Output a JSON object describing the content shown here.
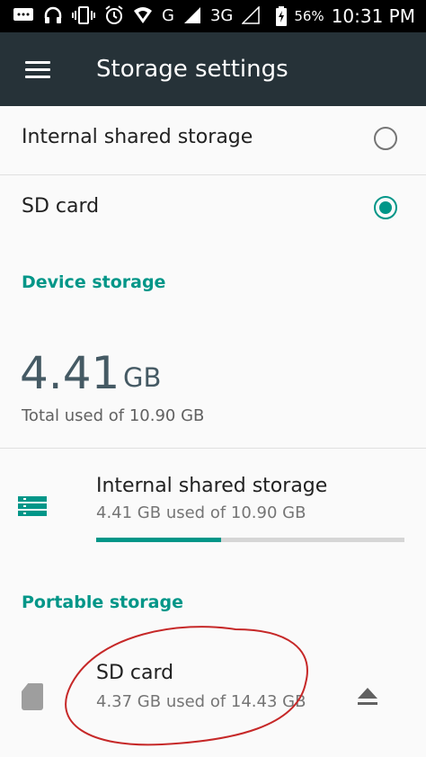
{
  "status_bar": {
    "battery_percent": "56%",
    "network": "3G",
    "carrier_letter": "G",
    "time": "10:31 PM"
  },
  "toolbar": {
    "title": "Storage settings"
  },
  "storage_options": [
    {
      "label": "Internal shared storage",
      "selected": false
    },
    {
      "label": "SD card",
      "selected": true
    }
  ],
  "device_storage": {
    "section_title": "Device storage",
    "used_value": "4.41",
    "used_unit": "GB",
    "total_text": "Total used of 10.90 GB",
    "volume": {
      "title": "Internal shared storage",
      "summary": "4.41 GB used of 10.90 GB",
      "usage_fraction": 0.405
    }
  },
  "portable_storage": {
    "section_title": "Portable storage",
    "volume": {
      "title": "SD card",
      "summary": "4.37 GB used of 14.43 GB"
    }
  },
  "colors": {
    "accent": "#009688",
    "toolbar": "#263238",
    "annotation": "#c62828"
  }
}
